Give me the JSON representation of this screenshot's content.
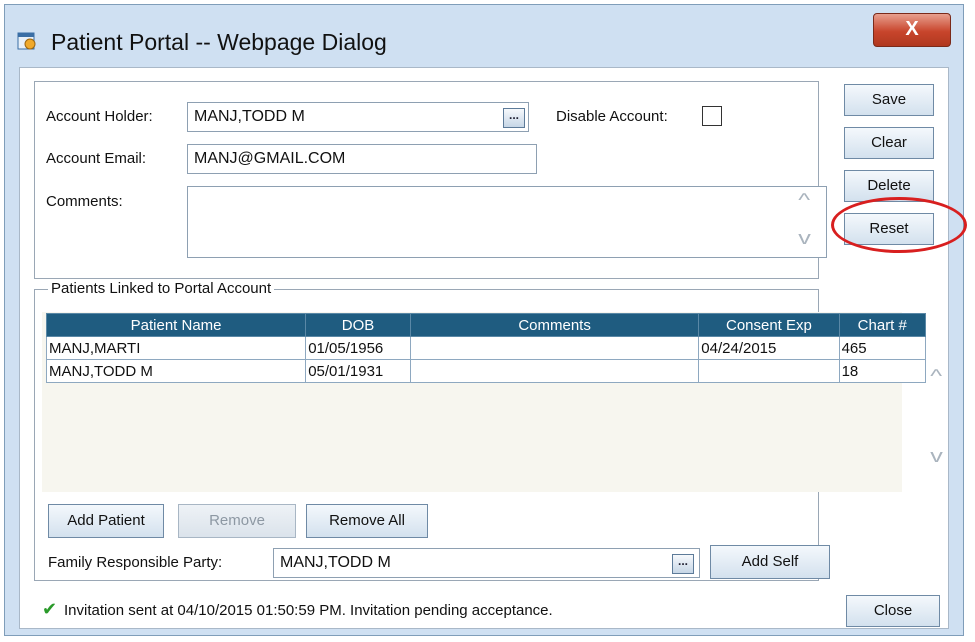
{
  "window": {
    "title": "Patient Portal -- Webpage Dialog",
    "close_label": "X"
  },
  "account": {
    "holder_label": "Account Holder:",
    "holder_value": "MANJ,TODD M",
    "email_label": "Account Email:",
    "email_value": "MANJ@GMAIL.COM",
    "comments_label": "Comments:",
    "comments_value": "",
    "disable_label": "Disable Account:",
    "disable_checked": false
  },
  "side_buttons": {
    "save": "Save",
    "clear": "Clear",
    "delete": "Delete",
    "reset": "Reset"
  },
  "patients": {
    "legend": "Patients Linked to Portal Account",
    "columns": [
      "Patient Name",
      "DOB",
      "Comments",
      "Consent Exp",
      "Chart #"
    ],
    "rows": [
      [
        "MANJ,MARTI",
        "01/05/1956",
        "",
        "04/24/2015",
        "465"
      ],
      [
        "MANJ,TODD M",
        "05/01/1931",
        "",
        "",
        "18"
      ]
    ]
  },
  "patient_buttons": {
    "add_patient": "Add Patient",
    "remove": "Remove",
    "remove_all": "Remove All"
  },
  "family": {
    "label": "Family Responsible Party:",
    "value": "MANJ,TODD M",
    "add_self": "Add Self"
  },
  "status": {
    "message": "Invitation sent at 04/10/2015 01:50:59 PM. Invitation pending acceptance."
  },
  "footer": {
    "close": "Close"
  },
  "colors": {
    "header_blue": "#1f5c80",
    "highlight_circle": "#d81f1f",
    "status_check": "#2a9a2a"
  }
}
